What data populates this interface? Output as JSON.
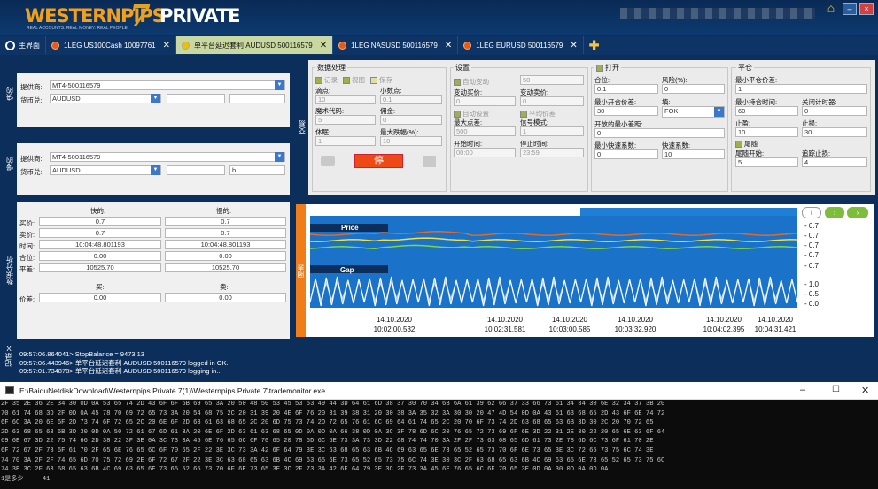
{
  "header": {
    "brand": "WESTERNPIPS",
    "brand_suffix": "PRIVATE",
    "version_glyph": "7",
    "tagline": "REAL ACCOUNTS. REAL MONEY. REAL PEOPLE"
  },
  "tabs": [
    {
      "label": "主界面"
    },
    {
      "label": "1LEG US100Cash 10097761"
    },
    {
      "label": "单平台延迟套利 AUDUSD 500116579"
    },
    {
      "label": "1LEG NASUSD 500116579"
    },
    {
      "label": "1LEG EURUSD 500116579"
    }
  ],
  "fast_panel": {
    "side_label": "快的",
    "provider_label": "提供商:",
    "provider": "MT4-500116579",
    "pair_label": "货币兑:",
    "pair": "AUDUSD"
  },
  "slow_panel": {
    "side_label": "慢的",
    "provider_label": "提供商:",
    "provider": "MT4-500116579",
    "pair_label": "货币兑:",
    "pair": "AUDUSD",
    "extra_value": "b"
  },
  "trade_label": "交易",
  "data_processing": {
    "title": "数据处理",
    "record": "记录",
    "view": "视图",
    "save": "保存",
    "tick_label": "滴点:",
    "tick": "10",
    "decimals_label": "小数点:",
    "decimals": "0.1",
    "magic_label": "魔术代码:",
    "magic": "5",
    "commission_label": "佣金:",
    "commission": "0",
    "rest_label": "休眠:",
    "rest": "1",
    "max_amp_label": "最大跌幅(%):",
    "max_amp": "10",
    "stop_button": "停"
  },
  "settings": {
    "title": "设置",
    "auto_change": "自动变动",
    "auto_change_val": "50",
    "change_buy_label": "变动买价:",
    "change_buy": "0",
    "change_sell_label": "变动卖价:",
    "change_sell": "0",
    "auto_settings": "自动设置",
    "avg_price": "平均价差",
    "max_points_label": "最大点差:",
    "max_points": "500",
    "signal_mode_label": "信号模式:",
    "signal_mode": "1",
    "start_time_label": "开始时间:",
    "start_time": "00:00",
    "stop_time_label": "停止时间:",
    "stop_time": "23:59"
  },
  "open": {
    "title": "打开",
    "position_label": "合位:",
    "position": "0.1",
    "risk_label": "风险(%):",
    "risk": "0",
    "min_open_label": "最小开合价差:",
    "min_open": "30",
    "fill_label": "填:",
    "fill": "FOK",
    "open_min_label": "开放的最小差距:",
    "open_min": "0",
    "min_fast_label": "最小快速系数:",
    "min_fast": "0",
    "fast_coef_label": "快速系数:",
    "fast_coef": "10"
  },
  "close": {
    "title": "平仓",
    "min_close_label": "最小平仓价差:",
    "min_close": "1",
    "min_hold_label": "最小持合时间:",
    "min_hold": "60",
    "close_timer_label": "关闭计时器:",
    "close_timer": "0",
    "sl_label": "止盈:",
    "sl": "10",
    "tp_label": "止损:",
    "tp": "30",
    "tail_label": "尾随",
    "tail_trigger_label": "尾随开始:",
    "tail_trigger": "5",
    "trail_stop_label": "追踪止损:",
    "trail_stop": "4"
  },
  "analysis": {
    "side_label": "数据分析",
    "fast_header": "快的:",
    "slow_header": "慢的:",
    "rows": [
      {
        "label": "买价:",
        "fast": "0.7",
        "slow": "0.7"
      },
      {
        "label": "卖价:",
        "fast": "0.7",
        "slow": "0.7"
      },
      {
        "label": "时间:",
        "fast": "10:04:48.801193",
        "slow": "10:04:48.801193"
      },
      {
        "label": "合位:",
        "fast": "0.00",
        "slow": "0.00"
      },
      {
        "label": "平差:",
        "fast": "10525.70",
        "slow": "10525.70"
      }
    ],
    "buy_header": "买:",
    "sell_header": "卖:",
    "price_label": "价差:",
    "buy_price": "0.00",
    "sell_price": "0.00"
  },
  "chart_side_label": "图表",
  "chart_data": {
    "type": "line",
    "panels": [
      {
        "name": "Price",
        "y_ticks": [
          "0.7",
          "0.7",
          "0.7",
          "0.7",
          "0.7"
        ]
      },
      {
        "name": "Gap",
        "y_ticks": [
          "1.0",
          "0.5",
          "0.0"
        ]
      }
    ],
    "x_labels": [
      {
        "date": "14.10.2020",
        "time": "10:02:00.532"
      },
      {
        "date": "14.10.2020",
        "time": "10:02:31.581"
      },
      {
        "date": "14.10.2020",
        "time": "10:03:00.585"
      },
      {
        "date": "14.10.2020",
        "time": "10:03:32.920"
      },
      {
        "date": "14.10.2020",
        "time": "10:04:02.395"
      },
      {
        "date": "14.10.2020",
        "time": "10:04:31.421"
      }
    ],
    "series": [
      {
        "color": "#e06a2a"
      },
      {
        "color": "#f0e040"
      },
      {
        "color": "#7dd83a"
      }
    ],
    "gap_series": [
      {
        "color": "#ffffff"
      },
      {
        "color": "#ffffff"
      }
    ]
  },
  "log": {
    "side_label": "记录",
    "lines": [
      "09:57:06.864041> StopBalance = 9473.13",
      "09:57:06.443946> 单平台延迟套利 AUDUSD 500116579 logged in OK.",
      "09:57:01.734878> 单平台延迟套利 AUDUSD 500116579 logging in..."
    ]
  },
  "console": {
    "title": "E:\\BaiduNetdiskDownload\\Westernpips Private 7(1)\\Westernpips Private 7\\trademonitor.exe",
    "lines": [
      "2F 35 2E 36 2E 34 30 0D 0A 53 65 74 2D 43 6F 6F 6B 69 65 3A 20 50 48 50 53 45 53 53 49 44 3D 64 61 6D 38 37 30 70 34 6B 6A 61 39 62 66 37 33 66 73 61 34 34 30 6E 32 34 37 3B 20",
      "70 61 74 68 3D 2F 0D 0A 45 78 70 69 72 65 73 3A 20 54 68 75 2C 20 31 39 20 4E 6F 76 20 31 39 38 31 20 30 38 3A 35 32 3A 30 30 20 47 4D 54 0D 0A 43 61 63 68 65 2D 43 6F 6E 74 72",
      "6F 6C 3A 20 6E 6F 2D 73 74 6F 72 65 2C 20 6E 6F 2D 63 61 63 68 65 2C 20 6D 75 73 74 2D 72 65 76 61 6C 69 64 61 74 65 2C 20 70 6F 73 74 2D 63 68 65 63 6B 3D 30 2C 20 70 72 65",
      "2D 63 68 65 63 6B 3D 30 0D 0A 50 72 61 67 6D 61 3A 20 6E 6F 2D 63 61 63 68 65 0D 0A 0D 0A 66 38 0D 0A 3C 3F 78 6D 6C 20 76 65 72 73 69 6F 6E 3D 22 31 2E 30 22 20 65 6E 63 6F 64",
      "69 6E 67 3D 22 75 74 66 2D 38 22 3F 3E 0A 3C 73 3A 45 6E 76 65 6C 6F 70 65 20 78 6D 6C 6E 73 3A 73 3D 22 68 74 74 70 3A 2F 2F 73 63 68 65 6D 61 73 2E 78 6D 6C 73 6F 61 70 2E",
      "6F 72 67 2F 73 6F 61 70 2F 65 6E 76 65 6C 6F 70 65 2F 22 3E 3C 73 3A 42 6F 64 79 3E 3C 63 68 65 63 6B 4C 69 63 65 6E 73 65 52 65 73 70 6F 6E 73 65 3E 3C 72 65 73 75 6C 74 3E",
      "74 70 3A 2F 2F 74 65 6D 70 75 72 69 2E 6F 72 67 2F 22 3E 3C 63 68 65 63 6B 4C 69 63 65 6E 73 65 52 65 73 75 6C 74 3E 30 3C 2F 63 68 65 63 6B 4C 69 63 65 6E 73 65 52 65 73 75 6C",
      "74 3E 3C 2F 63 68 65 63 6B 4C 69 63 65 6E 73 65 52 65 73 70 6F 6E 73 65 3E 3C 2F 73 3A 42 6F 64 79 3E 3C 2F 73 3A 45 6E 76 65 6C 6F 70 65 3E 0D 0A 30 0D 0A 0D 0A"
    ],
    "prompt_label": "1是多少",
    "prompt_value": "41"
  }
}
